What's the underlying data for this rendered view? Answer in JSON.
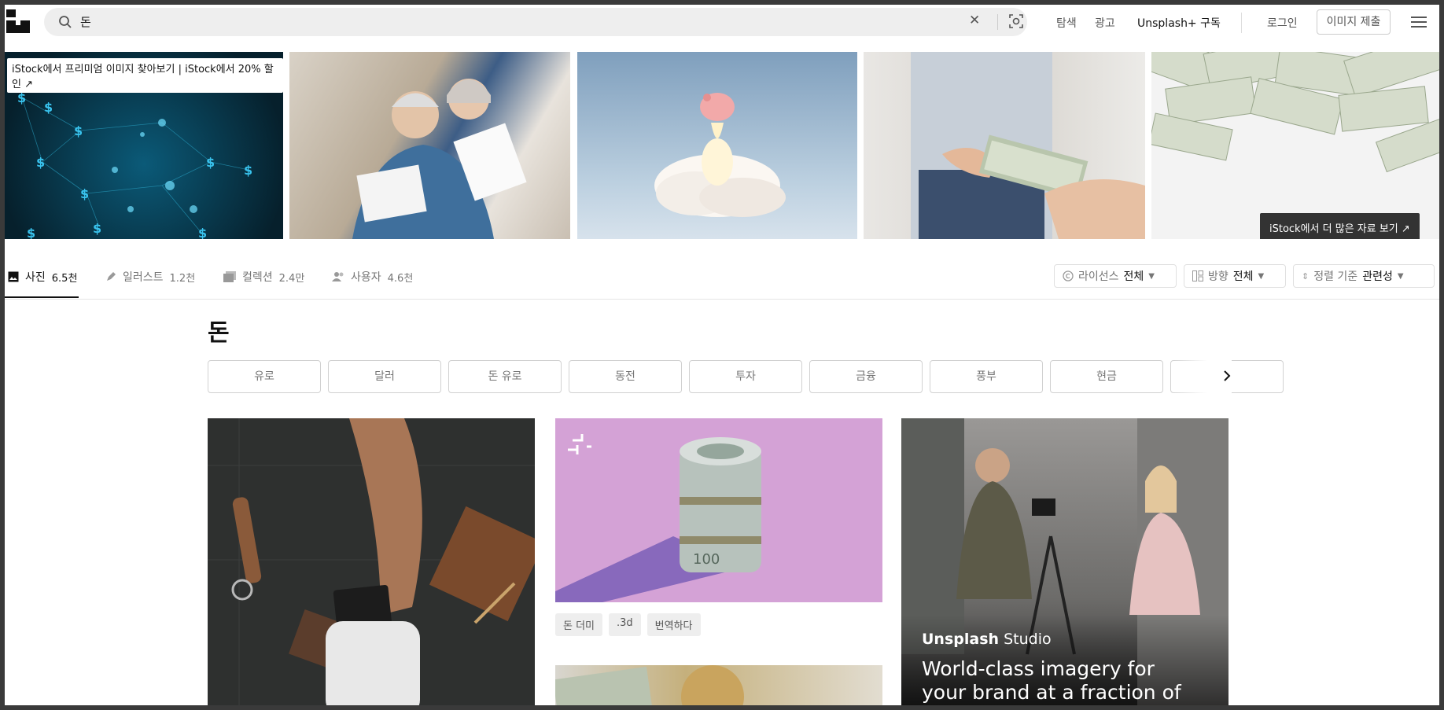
{
  "header": {
    "search": {
      "value": "돈",
      "placeholder": ""
    },
    "nav": {
      "explore": "탐색",
      "advertise": "광고",
      "plus": "Unsplash+ 구독",
      "login": "로그인",
      "submit": "이미지 제출"
    }
  },
  "banner": {
    "left_badge": "iStock에서 프리미엄 이미지 찾아보기 | iStock에서 20% 할인 ↗",
    "right_badge": "iStock에서 더 많은 자료 보기 ↗"
  },
  "tabs": [
    {
      "label": "사진",
      "count": "6.5천",
      "active": true
    },
    {
      "label": "일러스트",
      "count": "1.2천"
    },
    {
      "label": "컬렉션",
      "count": "2.4만"
    },
    {
      "label": "사용자",
      "count": "4.6천"
    }
  ],
  "filters": {
    "license": {
      "label": "라이선스",
      "value": "전체"
    },
    "orientation": {
      "label": "방향",
      "value": "전체"
    },
    "sort": {
      "label": "정렬 기준",
      "value": "관련성"
    }
  },
  "page": {
    "title": "돈"
  },
  "related_chips": [
    "유로",
    "달러",
    "돈 유로",
    "동전",
    "투자",
    "금융",
    "풍부",
    "현금"
  ],
  "photo_tags": [
    "돈 더미",
    ".3d",
    "번역하다"
  ],
  "promo": {
    "logo_brand": "Unsplash",
    "logo_suffix": "Studio",
    "headline": "World-class imagery for your brand at a fraction of the"
  },
  "colors": {
    "accent": "#111111",
    "muted": "#767676"
  }
}
